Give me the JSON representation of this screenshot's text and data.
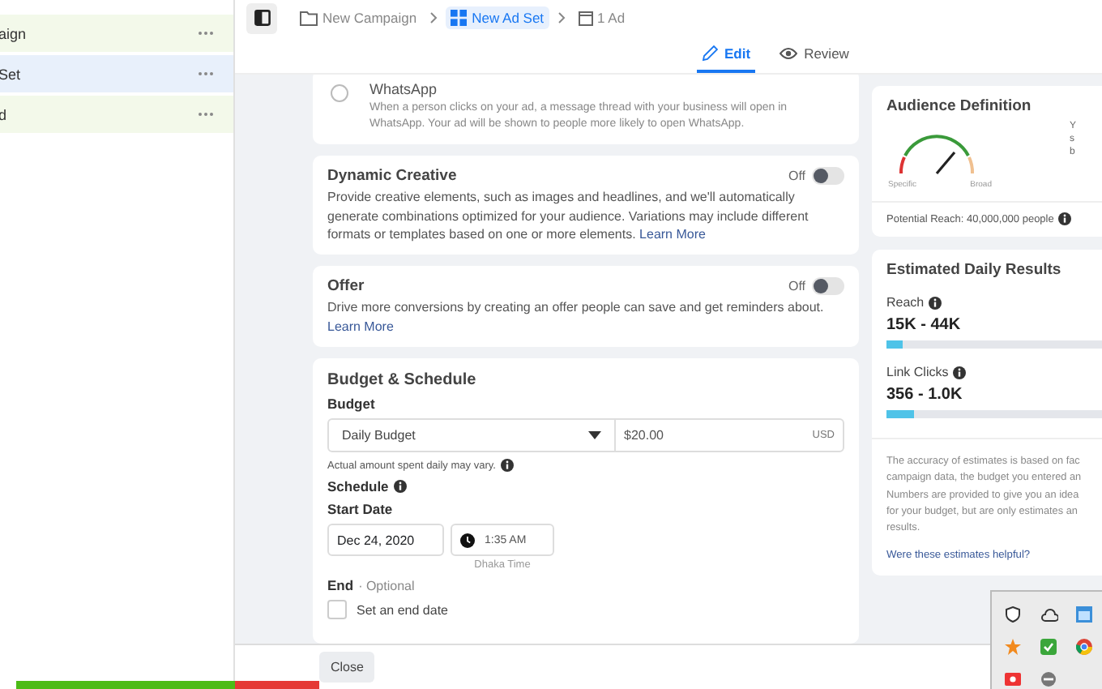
{
  "sidebar": {
    "items": [
      {
        "label": "aign",
        "selected": false
      },
      {
        "label": "Set",
        "selected": true
      },
      {
        "label": "d",
        "selected": false
      }
    ]
  },
  "breadcrumb": [
    {
      "label": "New Campaign",
      "kind": "folder",
      "selected": false
    },
    {
      "label": "New Ad Set",
      "kind": "grid",
      "selected": true
    },
    {
      "label": "1 Ad",
      "kind": "ad",
      "selected": false
    }
  ],
  "tabs": [
    {
      "label": "Edit",
      "kind": "edit",
      "selected": true
    },
    {
      "label": "Review",
      "kind": "review",
      "selected": false
    }
  ],
  "whatsapp": {
    "title": "WhatsApp",
    "description": "When a person clicks on your ad, a message thread with your business will open in WhatsApp. Your ad will be shown to people more likely to open WhatsApp.",
    "selected": false
  },
  "options": [
    {
      "title": "Dynamic Creative",
      "description": "Provide creative elements, such as images and headlines, and we'll automatically generate combinations optimized for your audience. Variations may include different formats or templates based on one or more elements.",
      "link": "Learn More",
      "toggle_label": "Off",
      "on": false
    },
    {
      "title": "Offer",
      "description": "Drive more conversions by creating an offer people can save and get reminders about.",
      "link": "Learn More",
      "toggle_label": "Off",
      "on": false
    }
  ],
  "budget": {
    "title": "Budget & Schedule",
    "budget_label": "Budget",
    "budget_type": "Daily Budget",
    "amount": "$20.00",
    "currency": "USD",
    "note": "Actual amount spent daily may vary.",
    "schedule_label": "Schedule",
    "start_label": "Start Date",
    "start_date": "Dec 24, 2020",
    "start_time": "1:35 AM",
    "timezone": "Dhaka Time",
    "end_label": "End",
    "end_optional": "· Optional",
    "end_checkbox": {
      "label": "Set an end date",
      "checked": false
    }
  },
  "audience": {
    "title": "Audience Definition",
    "gauge_low": "Specific",
    "gauge_high": "Broad",
    "side_text": [
      "Y",
      "s",
      "b"
    ],
    "potential_reach": "Potential Reach: 40,000,000 people"
  },
  "estimates": {
    "title": "Estimated Daily Results",
    "metrics": [
      {
        "label": "Reach",
        "value": "15K - 44K",
        "level": 0.07
      },
      {
        "label": "Link Clicks",
        "value": "356 - 1.0K",
        "level": 0.12
      }
    ],
    "disclaimer": [
      "The accuracy of estimates is based on fac",
      "campaign data, the budget you entered an",
      "Numbers are provided to give you an idea",
      "for your budget, but are only estimates an",
      "results."
    ],
    "feedback_link": "Were these estimates helpful?"
  },
  "footer": {
    "close": "Close"
  }
}
